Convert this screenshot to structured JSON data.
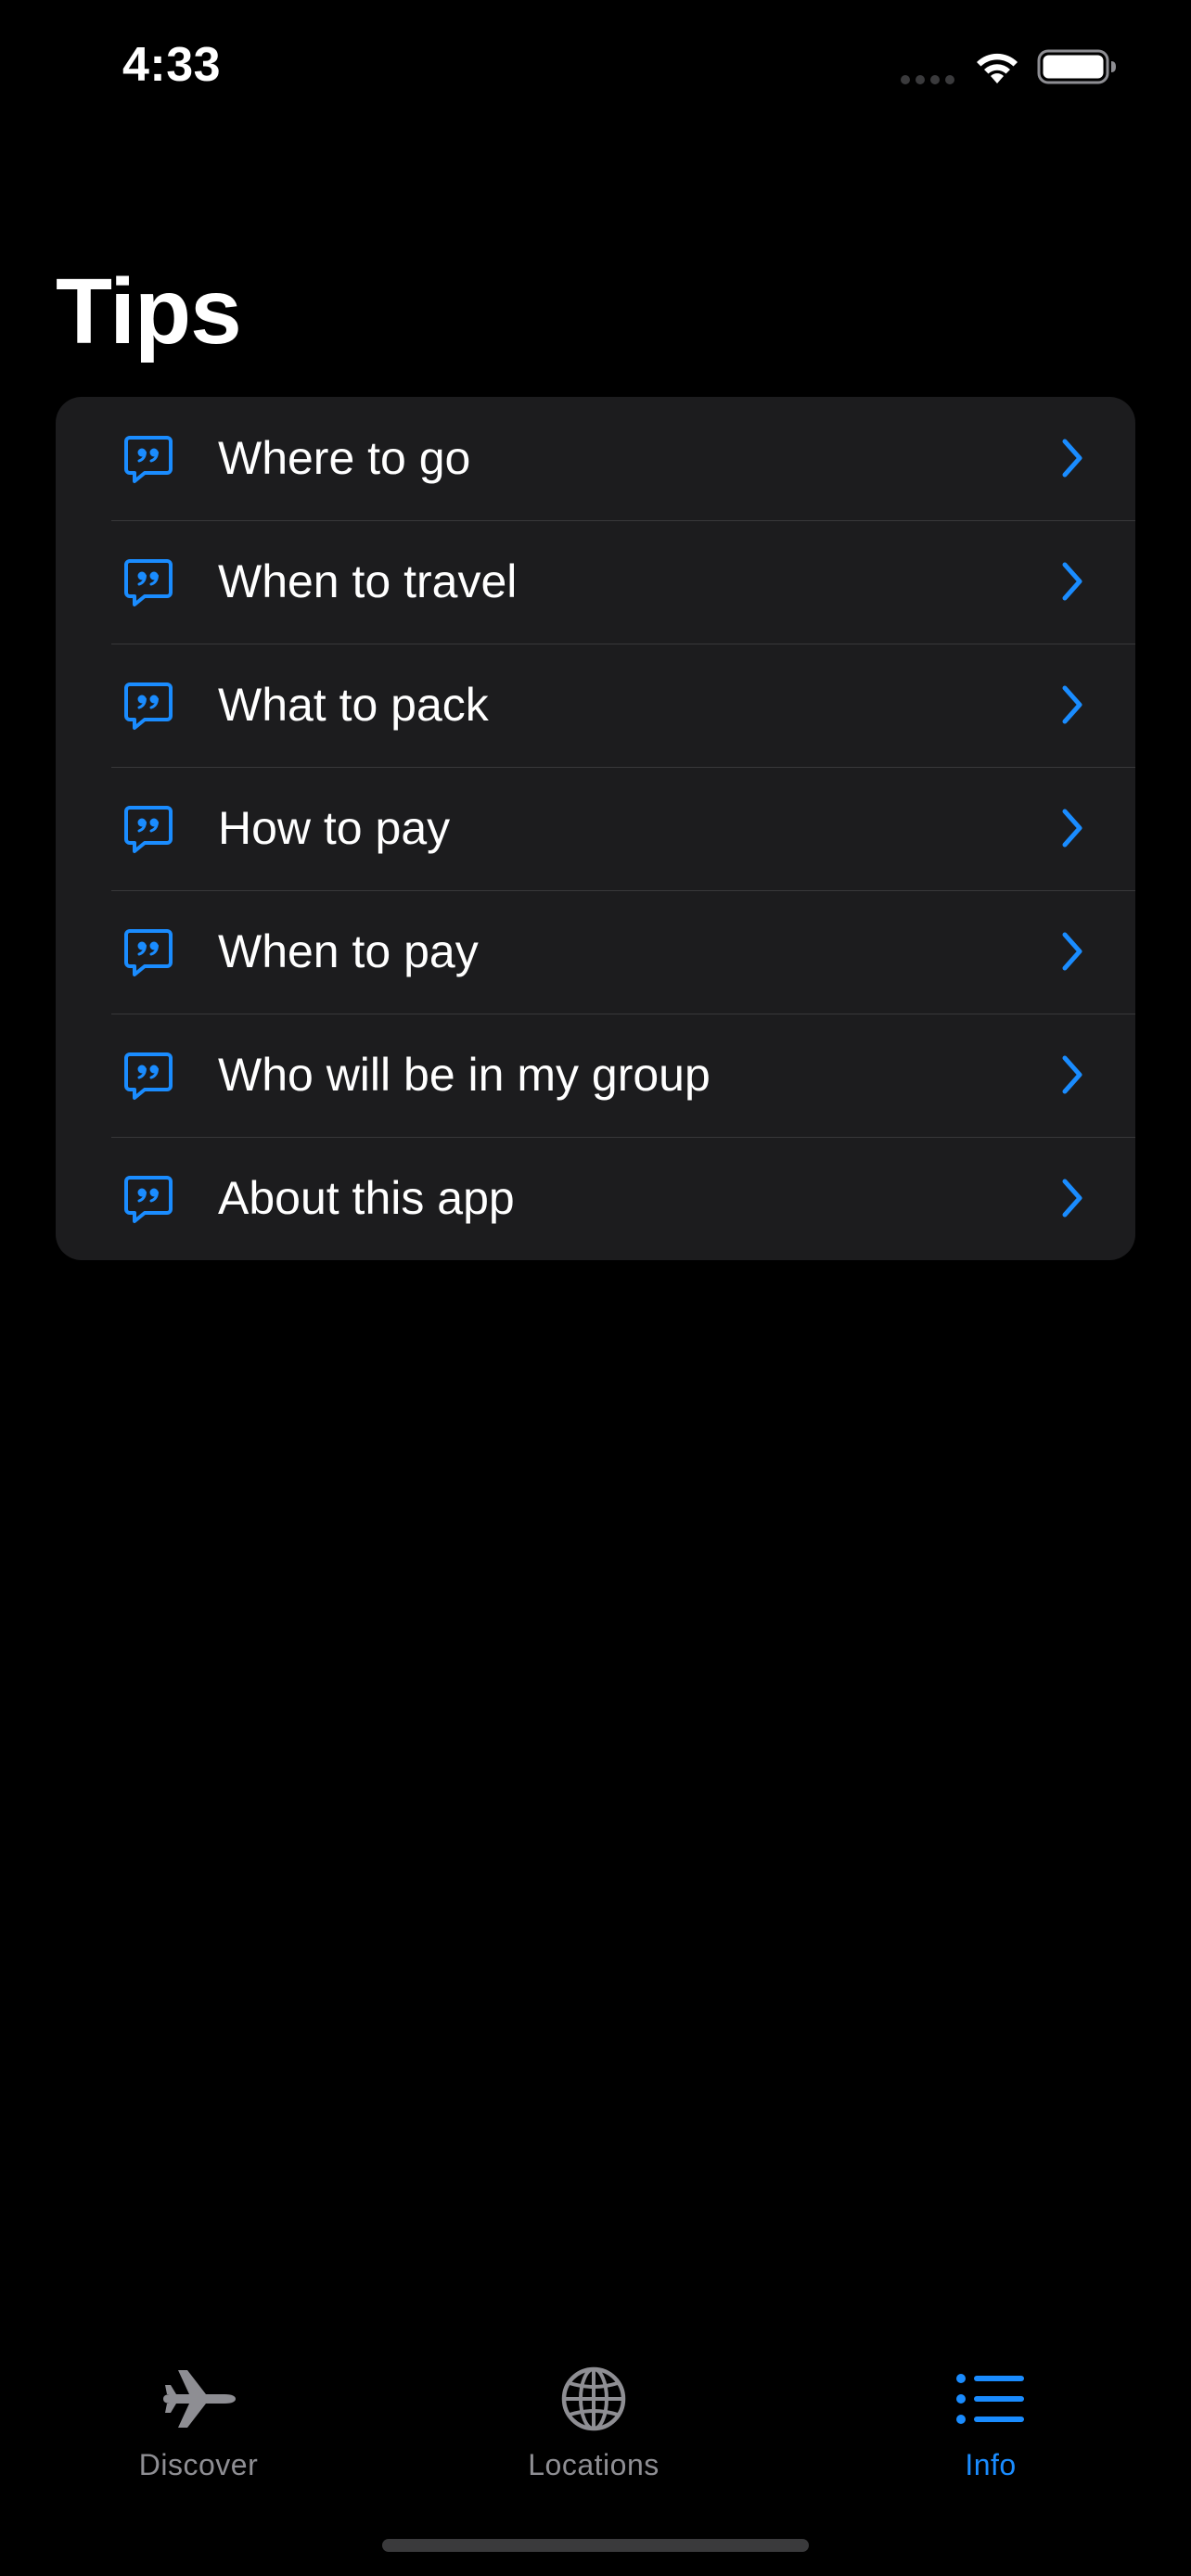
{
  "status_bar": {
    "time": "4:33"
  },
  "page": {
    "title": "Tips"
  },
  "colors": {
    "accent": "#1a8cff",
    "inactive_tab": "#8e8e93",
    "card_background": "#1c1c1e",
    "separator": "#38383a"
  },
  "tips": {
    "icon": "quote-bubble-icon",
    "items": [
      {
        "label": "Where to go"
      },
      {
        "label": "When to travel"
      },
      {
        "label": "What to pack"
      },
      {
        "label": "How to pay"
      },
      {
        "label": "When to pay"
      },
      {
        "label": "Who will be in my group"
      },
      {
        "label": "About this app"
      }
    ]
  },
  "tab_bar": {
    "tabs": [
      {
        "label": "Discover",
        "icon": "airplane-icon",
        "selected": false
      },
      {
        "label": "Locations",
        "icon": "globe-icon",
        "selected": false
      },
      {
        "label": "Info",
        "icon": "list-icon",
        "selected": true
      }
    ]
  }
}
